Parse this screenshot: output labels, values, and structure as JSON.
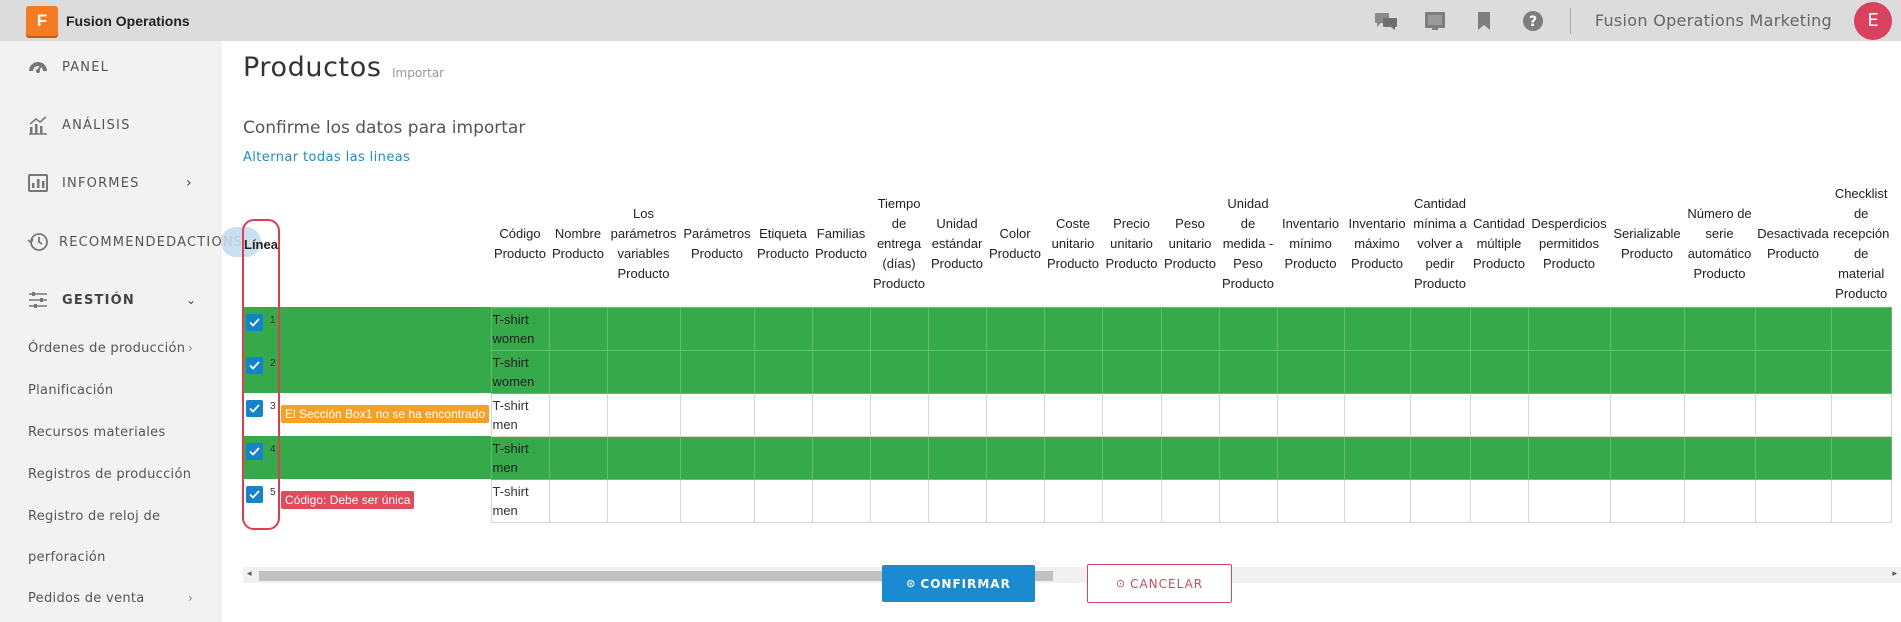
{
  "app": {
    "logo_letter": "F",
    "title": "Fusion Operations",
    "org": "Fusion Operations Marketing",
    "avatar_letter": "E",
    "brand_color": "#f47b20"
  },
  "top_icons": [
    "chat-icon",
    "presentation-icon",
    "bookmark-icon",
    "help-icon"
  ],
  "sidebar": {
    "items": [
      {
        "label": "PANEL",
        "icon": "speedometer-icon"
      },
      {
        "label": "ANÁLISIS",
        "icon": "chart-icon"
      },
      {
        "label": "INFORMES",
        "icon": "report-icon"
      },
      {
        "label": "RECOMMENDEDACTIONS",
        "icon": "history-icon"
      },
      {
        "label": "GESTIÓN",
        "icon": "sliders-icon"
      }
    ],
    "sub_items": [
      {
        "label": "Órdenes de producción",
        "has_chevron": true
      },
      {
        "label": "Planificación",
        "has_chevron": false
      },
      {
        "label": "Recursos materiales",
        "has_chevron": false
      },
      {
        "label": "Registros de producción",
        "has_chevron": false
      },
      {
        "label": "Registro de reloj de",
        "has_chevron": false
      },
      {
        "label": "perforación",
        "has_chevron": false
      },
      {
        "label": "Pedidos de venta",
        "has_chevron": true
      }
    ]
  },
  "main": {
    "title": "Productos",
    "subtitle": "Importar",
    "confirm_heading": "Confirme los datos para importar",
    "toggle_all": "Alternar todas las lineas",
    "columns": [
      "Línea",
      "Código Producto",
      "Nombre Producto",
      "Los parámetros variables Producto",
      "Parámetros Producto",
      "Etiqueta Producto",
      "Familias Producto",
      "Tiempo de entrega (días) Producto",
      "Unidad estándar Producto",
      "Color Producto",
      "Coste unitario Producto",
      "Precio unitario Producto",
      "Peso unitario Producto",
      "Unidad de medida - Peso Producto",
      "Inventario mínimo Producto",
      "Inventario máximo Producto",
      "Cantidad mínima a volver a pedir Producto",
      "Cantidad múltiple Producto",
      "Desperdicios permitidos Producto",
      "Serializable Producto",
      "Número de serie automático Producto",
      "Desactivada Producto",
      "Checklist de recepción de material Producto"
    ],
    "rows": [
      {
        "num": "1",
        "checked": true,
        "code": "T-shirt women",
        "status": "ok",
        "error": ""
      },
      {
        "num": "2",
        "checked": true,
        "code": "T-shirt women",
        "status": "ok",
        "error": ""
      },
      {
        "num": "3",
        "checked": true,
        "code": "T-shirt men",
        "status": "error",
        "error": "El Sección Box1 no se ha encontrado",
        "error_color": "#f5a127"
      },
      {
        "num": "4",
        "checked": true,
        "code": "T-shirt men",
        "status": "ok",
        "error": ""
      },
      {
        "num": "5",
        "checked": true,
        "code": "T-shirt men",
        "status": "error",
        "error": "Código: Debe ser única",
        "error_color": "#e24b5c"
      }
    ],
    "ok_color": "#36a94b"
  },
  "buttons": {
    "confirm": "CONFIRMAR",
    "cancel": "CANCELAR",
    "confirm_color": "#1a8bd1",
    "cancel_color": "#d04a5c"
  }
}
